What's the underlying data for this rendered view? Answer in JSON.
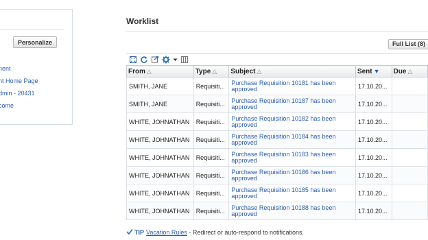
{
  "left_panel": {
    "personalize_label": "Personalize",
    "links": [
      "nent",
      "nt Home Page",
      "dmin - 20431",
      "come"
    ]
  },
  "worklist": {
    "title": "Worklist",
    "full_list_label": "Full List (8)",
    "columns": [
      "From",
      "Type",
      "Subject",
      "Sent",
      "Due"
    ],
    "rows": [
      {
        "from": "SMITH, JANE",
        "type": "Requisiti...",
        "subject": "Purchase Requisition 10181 has been approved",
        "sent": "17.10.20..."
      },
      {
        "from": "SMITH, JANE",
        "type": "Requisiti...",
        "subject": "Purchase Requisition 10187 has been approved",
        "sent": "17.10.20..."
      },
      {
        "from": "WHITE, JOHNATHAN",
        "type": "Requisiti...",
        "subject": "Purchase Requisition 10182 has been approved",
        "sent": "17.10.20..."
      },
      {
        "from": "WHITE, JOHNATHAN",
        "type": "Requisiti...",
        "subject": "Purchase Requisition 10184 has been approved",
        "sent": "17.10.20..."
      },
      {
        "from": "WHITE, JOHNATHAN",
        "type": "Requisiti...",
        "subject": "Purchase Requisition 10183 has been approved",
        "sent": "17.10.20..."
      },
      {
        "from": "WHITE, JOHNATHAN",
        "type": "Requisiti...",
        "subject": "Purchase Requisition 10186 has been approved",
        "sent": "17.10.20..."
      },
      {
        "from": "WHITE, JOHNATHAN",
        "type": "Requisiti...",
        "subject": "Purchase Requisition 10185 has been approved",
        "sent": "17.10.20..."
      },
      {
        "from": "WHITE, JOHNATHAN",
        "type": "Requisiti...",
        "subject": "Purchase Requisition 10188 has been approved",
        "sent": "17.10.20..."
      }
    ]
  },
  "toolbar_icons": [
    "expand-icon",
    "refresh-icon",
    "export-icon",
    "gear-icon",
    "chevron-down-icon",
    "columns-icon"
  ],
  "tip": {
    "label": "TIP",
    "link_text": "Vacation Rules",
    "text": " - Redirect or auto-respond to notifications."
  },
  "colors": {
    "link": "#2a5db0",
    "border": "#c8ccd2",
    "header_bg": "#e8eaed",
    "gear": "#2a6fb8"
  }
}
